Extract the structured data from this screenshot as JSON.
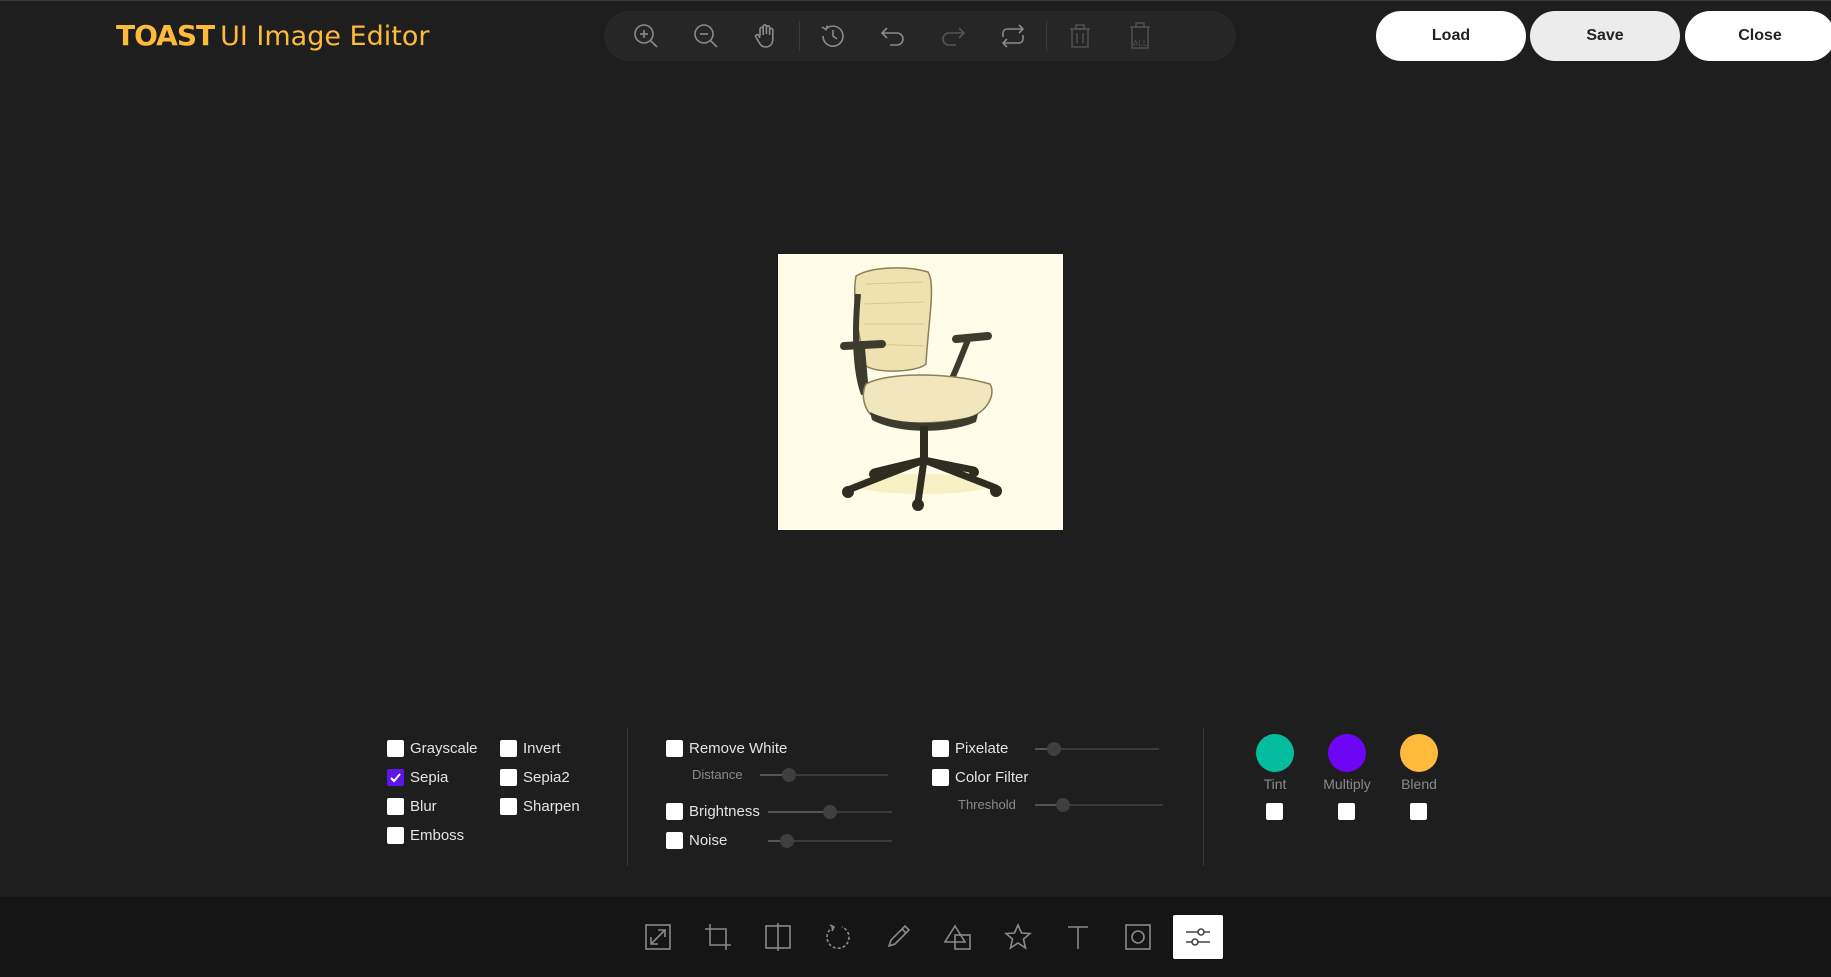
{
  "header": {
    "logo_brand": "TOAST",
    "logo_title": "UI Image Editor",
    "buttons": {
      "load": "Load",
      "save": "Save",
      "close": "Close"
    }
  },
  "top_toolbar": [
    {
      "name": "zoom-in-icon"
    },
    {
      "name": "zoom-out-icon"
    },
    {
      "name": "hand-icon"
    },
    {
      "name": "history-icon"
    },
    {
      "name": "undo-icon"
    },
    {
      "name": "redo-icon"
    },
    {
      "name": "reset-icon"
    },
    {
      "name": "delete-icon"
    },
    {
      "name": "delete-all-icon",
      "label": "ALL"
    }
  ],
  "filters": {
    "grayscale": {
      "label": "Grayscale",
      "checked": false
    },
    "invert": {
      "label": "Invert",
      "checked": false
    },
    "sepia": {
      "label": "Sepia",
      "checked": true
    },
    "sepia2": {
      "label": "Sepia2",
      "checked": false
    },
    "blur": {
      "label": "Blur",
      "checked": false
    },
    "sharpen": {
      "label": "Sharpen",
      "checked": false
    },
    "emboss": {
      "label": "Emboss",
      "checked": false
    },
    "remove_white": {
      "label": "Remove White",
      "checked": false,
      "sub_label": "Distance",
      "value": 0.23
    },
    "brightness": {
      "label": "Brightness",
      "checked": false,
      "value": 0.5
    },
    "noise": {
      "label": "Noise",
      "checked": false,
      "value": 0.15
    },
    "pixelate": {
      "label": "Pixelate",
      "checked": false,
      "value": 0.15
    },
    "color_filter": {
      "label": "Color Filter",
      "checked": false,
      "sub_label": "Threshold",
      "value": 0.22
    },
    "tint": {
      "label": "Tint",
      "color": "#03bd9e",
      "checked": false
    },
    "multiply": {
      "label": "Multiply",
      "color": "#6f05f5",
      "checked": false
    },
    "blend": {
      "label": "Blend",
      "color": "#fdba3b",
      "checked": false
    }
  },
  "bottom_menu": [
    {
      "name": "resize-icon"
    },
    {
      "name": "crop-icon"
    },
    {
      "name": "flip-icon"
    },
    {
      "name": "rotate-icon"
    },
    {
      "name": "draw-icon"
    },
    {
      "name": "shape-icon"
    },
    {
      "name": "icon-star-icon"
    },
    {
      "name": "text-icon"
    },
    {
      "name": "mask-icon"
    },
    {
      "name": "filter-icon",
      "active": true
    }
  ],
  "colors": {
    "background": "#1e1e1e",
    "accent": "#fdba3b",
    "checkbox_checked": "#5e16e6"
  }
}
